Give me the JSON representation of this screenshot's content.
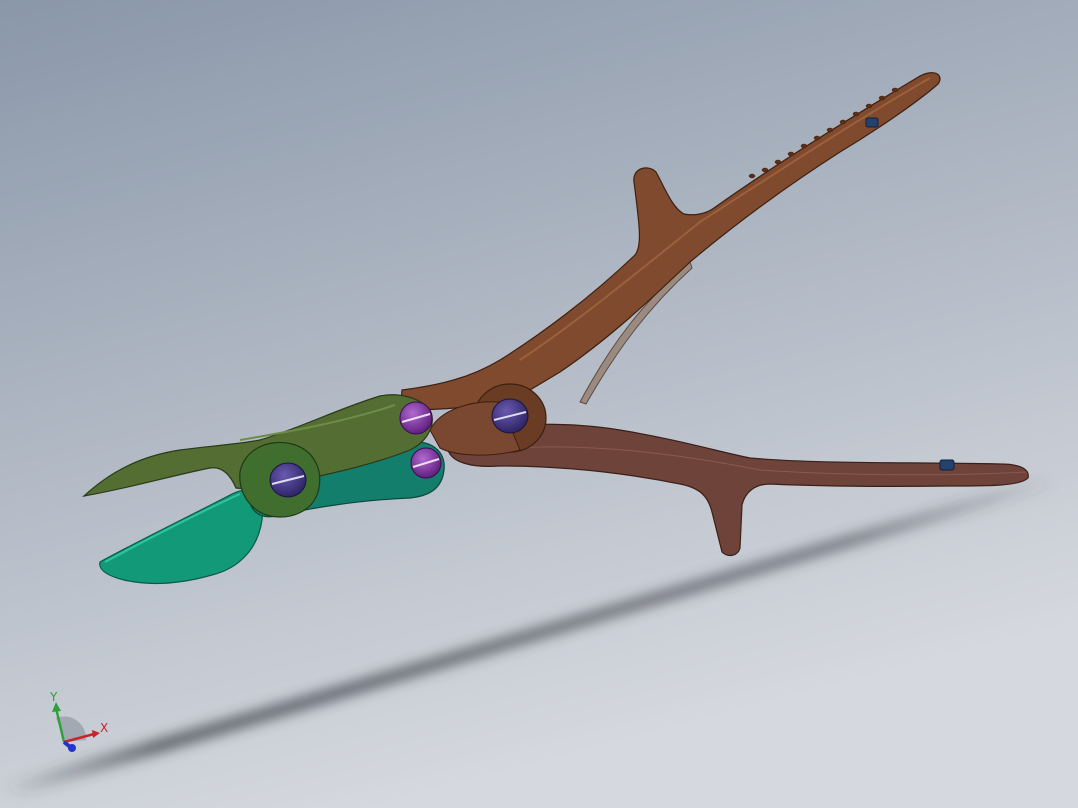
{
  "viewport": {
    "background_top": "#8a97a9",
    "background_bottom": "#d5d8de",
    "floor_shadow": "#3b3f47"
  },
  "model": {
    "upper_jaw_color": "#536d33",
    "lower_jaw_color": "#129a78",
    "link_color": "#3f6e2e",
    "lower_link_color": "#137e6b",
    "upper_handle_color": "#7f4a2d",
    "lower_handle_color": "#6e4339",
    "spring_color": "#9a8a80",
    "pivot_screw_color": "#3d2f78",
    "link_screw_color": "#7b2d9a",
    "stop_screw_color": "#24426e"
  },
  "triad": {
    "x_label": "X",
    "y_label": "Y",
    "x_color": "#c8242b",
    "y_color": "#2ea03c",
    "z_color": "#2433c8"
  }
}
